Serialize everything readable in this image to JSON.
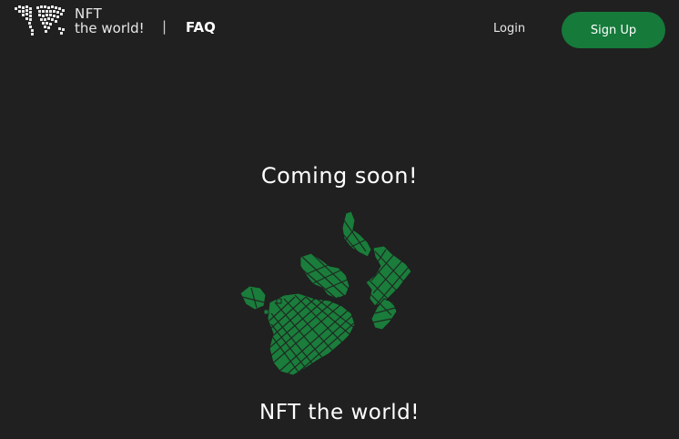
{
  "header": {
    "brand_line1": "NFT",
    "brand_line2": "the world!",
    "separator": "|",
    "faq_label": "FAQ",
    "login_label": "Login",
    "signup_label": "Sign Up"
  },
  "main": {
    "headline": "Coming soon!",
    "tagline": "NFT the world!"
  },
  "colors": {
    "background": "#202020",
    "accent": "#157a3a",
    "map_green": "#1a7d3b",
    "text": "#ffffff"
  },
  "icons": {
    "logo": "world-map-logo-icon",
    "hero": "pixel-world-map-icon"
  }
}
